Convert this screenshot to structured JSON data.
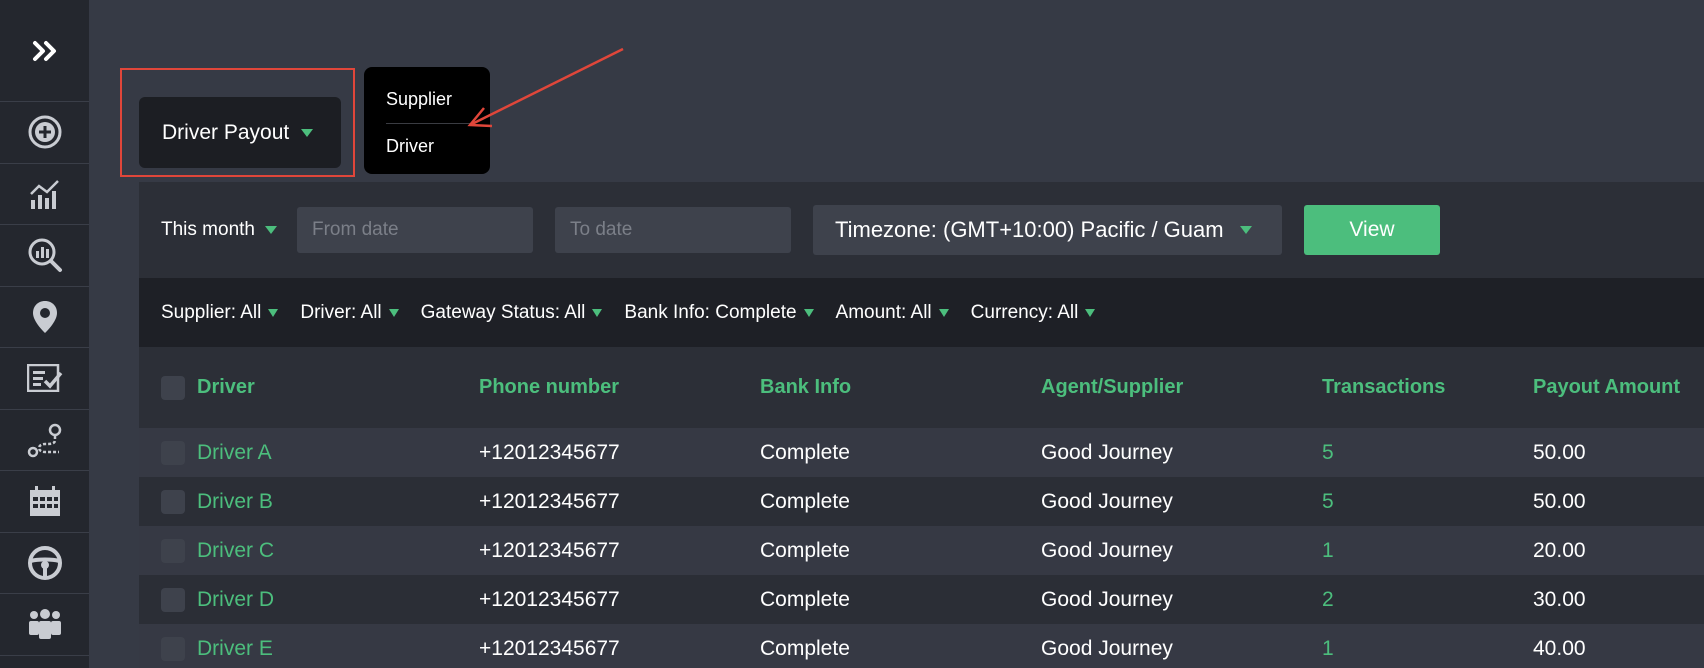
{
  "report_selector": {
    "value": "Driver Payout"
  },
  "report_menu": {
    "options": [
      "Supplier",
      "Driver"
    ]
  },
  "filters": {
    "period": "This month",
    "from_date_placeholder": "From date",
    "to_date_placeholder": "To date",
    "timezone": "Timezone: (GMT+10:00) Pacific / Guam",
    "view_label": "View"
  },
  "quick_filters": [
    "Supplier: All",
    "Driver: All",
    "Gateway Status: All",
    "Bank Info: Complete",
    "Amount: All",
    "Currency: All"
  ],
  "table": {
    "headers": [
      "Driver",
      "Phone number",
      "Bank Info",
      "Agent/Supplier",
      "Transactions",
      "Payout Amount"
    ],
    "rows": [
      {
        "driver": "Driver A",
        "phone": "+12012345677",
        "bank": "Complete",
        "agent": "Good Journey",
        "transactions": "5",
        "payout": "50.00"
      },
      {
        "driver": "Driver B",
        "phone": "+12012345677",
        "bank": "Complete",
        "agent": "Good Journey",
        "transactions": "5",
        "payout": "50.00"
      },
      {
        "driver": "Driver C",
        "phone": "+12012345677",
        "bank": "Complete",
        "agent": "Good Journey",
        "transactions": "1",
        "payout": "20.00"
      },
      {
        "driver": "Driver D",
        "phone": "+12012345677",
        "bank": "Complete",
        "agent": "Good Journey",
        "transactions": "2",
        "payout": "30.00"
      },
      {
        "driver": "Driver E",
        "phone": "+12012345677",
        "bank": "Complete",
        "agent": "Good Journey",
        "transactions": "1",
        "payout": "40.00"
      }
    ]
  },
  "colors": {
    "accent": "#4cbe7d",
    "annotation": "#e0463a",
    "sidebar": "#24272e",
    "background": "#363a45"
  },
  "sidebar": {
    "icons": [
      "expand-icon",
      "add-circle-icon",
      "analytics-icon",
      "search-chart-icon",
      "location-pin-icon",
      "checklist-icon",
      "route-icon",
      "calendar-icon",
      "steering-wheel-icon",
      "team-icon"
    ]
  }
}
